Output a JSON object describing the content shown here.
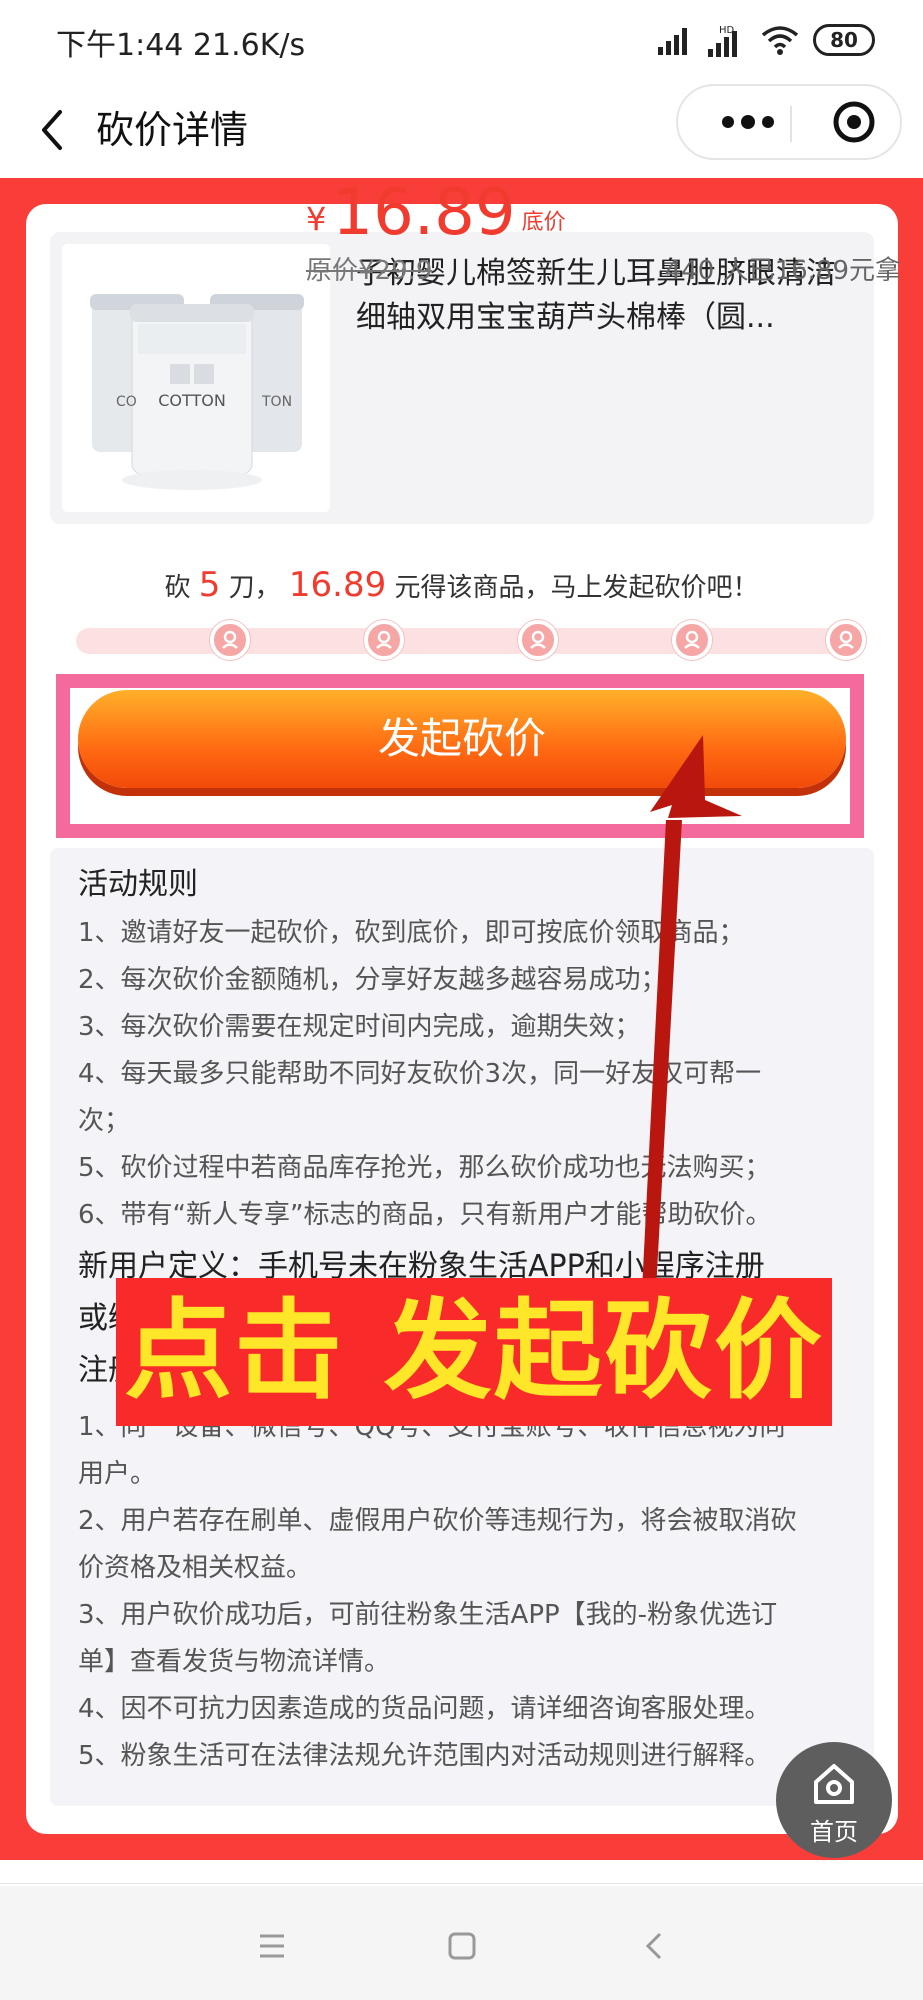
{
  "status_bar": {
    "time": "下午1:44 21.6K/s",
    "battery": "80",
    "icons": [
      "signal-icon",
      "hd-signal-icon",
      "wifi-icon",
      "battery-icon"
    ]
  },
  "nav": {
    "title": "砍价详情",
    "back_icon": "chevron-left-icon",
    "more_icon": "more-dots-icon",
    "close_icon": "target-circle-icon"
  },
  "product": {
    "title": "子初婴儿棉签新生儿耳鼻肚脐眼清洁细轴双用宝宝葫芦头棉棒（圆...",
    "image_label": "COTTON",
    "currency": "¥",
    "price": "16.89",
    "price_tag": "底价",
    "original_price": "原价¥29.9",
    "sold": "440 人已16.89元拿"
  },
  "bargain": {
    "hint_prefix": "砍",
    "cuts": "5",
    "hint_mid": "刀，",
    "target_price": "16.89",
    "hint_suffix": "元得该商品，马上发起砍价吧！",
    "progress_steps": 5,
    "button_label": "发起砍价"
  },
  "rules": {
    "title": "活动规则",
    "items": [
      "1、邀请好友一起砍价，砍到底价，即可按底价领取商品；",
      "2、每次砍价金额随机，分享好友越多越容易成功；",
      "3、每次砍价需要在规定时间内完成，逾期失效；",
      "4、每天最多只能帮助不同好友砍价3次，同一好友仅可帮一",
      "次；",
      "5、砍价过程中若商品库存抢光，那么砍价成功也无法购买；",
      "6、带有“新人专享”标志的商品，只有新用户才能帮助砍价。"
    ],
    "definition_lines": [
      "新用户定义：手机号未在粉象生活APP和小程序注册",
      "或绑",
      "注册"
    ],
    "more_items": [
      "1、同一设备、微信号、QQ号、支付宝账号、收件信息视为同",
      "用户。",
      "2、用户若存在刷单、虚假用户砍价等违规行为，将会被取消砍",
      "价资格及相关权益。",
      "3、用户砍价成功后，可前往粉象生活APP【我的-粉象优选订",
      "单】查看发货与物流详情。",
      "4、因不可抗力因素造成的货品问题，请详细咨询客服处理。",
      "5、粉象生活可在法律法规允许范围内对活动规则进行解释。"
    ]
  },
  "annotation": {
    "overlay_text": "点击 发起砍价"
  },
  "home_button": {
    "label": "首页",
    "icon": "home-icon"
  },
  "system_nav": {
    "icons": [
      "menu-icon",
      "home-square-icon",
      "back-icon"
    ]
  },
  "colors": {
    "page_red": "#f93d38",
    "price_red": "#f23b2f",
    "button_orange": "#ff6a12",
    "highlight_pink": "#f46a9c",
    "overlay_yellow": "#ffe628",
    "arrow_dark_red": "#b8160e"
  }
}
